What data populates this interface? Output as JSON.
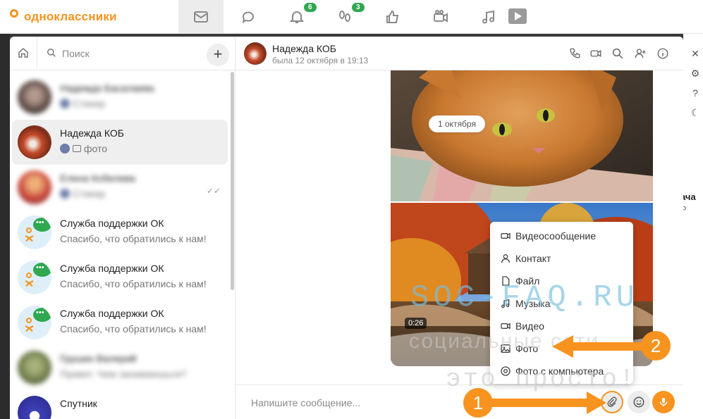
{
  "brand": {
    "name": "одноклассники",
    "color": "#f7931e"
  },
  "topnav": {
    "items": [
      {
        "name": "messages",
        "icon": "envelope-icon",
        "active": true
      },
      {
        "name": "discussions",
        "icon": "chat-bubbles-icon"
      },
      {
        "name": "notifications",
        "icon": "bell-icon",
        "badge": "6"
      },
      {
        "name": "guests",
        "icon": "footprints-icon",
        "badge": "3"
      },
      {
        "name": "events",
        "icon": "thumbs-up-icon"
      },
      {
        "name": "video",
        "icon": "video-camera-icon"
      },
      {
        "name": "music",
        "icon": "music-note-icon"
      }
    ]
  },
  "sidebar_right": {
    "icons": [
      "close-icon",
      "gear-icon",
      "help-icon",
      "moon-icon"
    ],
    "bg_text_1": "ача",
    "bg_text_2": "Р"
  },
  "chatlist": {
    "search_placeholder": "Поиск",
    "items": [
      {
        "name": "Надежда Басалаева",
        "preview": "Стикер",
        "blurred": true
      },
      {
        "name": "Надежда КОБ",
        "preview": "фото",
        "selected": true
      },
      {
        "name": "Елена Кобелева",
        "preview": "Стикер",
        "blurred": true,
        "read": "✓✓"
      },
      {
        "name": "Служба поддержки ОК",
        "preview": "Спасибо, что обратились к нам!"
      },
      {
        "name": "Служба поддержки ОК",
        "preview": "Спасибо, что обратились к нам!"
      },
      {
        "name": "Служба поддержки ОК",
        "preview": "Спасибо, что обратились к нам!"
      },
      {
        "name": "Грушин Валерий",
        "preview": "Привет. Чем занимаешься?",
        "blurred": true
      },
      {
        "name": "Спутник",
        "preview": ""
      }
    ]
  },
  "conversation": {
    "name": "Надежда КОБ",
    "status": "была 12 октября в 19:13",
    "date_pill": "1 октября",
    "video_duration": "0:26",
    "composer_placeholder": "Напишите сообщение..."
  },
  "attach_menu": {
    "items": [
      {
        "label": "Видеосообщение",
        "icon": "video-message-icon"
      },
      {
        "label": "Контакт",
        "icon": "person-icon"
      },
      {
        "label": "Файл",
        "icon": "file-icon"
      },
      {
        "label": "Музыка",
        "icon": "music-note-icon"
      },
      {
        "label": "Видео",
        "icon": "video-camera-icon"
      },
      {
        "label": "Фото",
        "icon": "image-icon"
      },
      {
        "label": "Фото с компьютера",
        "icon": "camera-icon"
      }
    ]
  },
  "watermark": {
    "line1": "SOC-FAQ.RU",
    "line2": "социальные сети",
    "line3": "это просто!"
  },
  "steps": {
    "one": "1",
    "two": "2"
  }
}
